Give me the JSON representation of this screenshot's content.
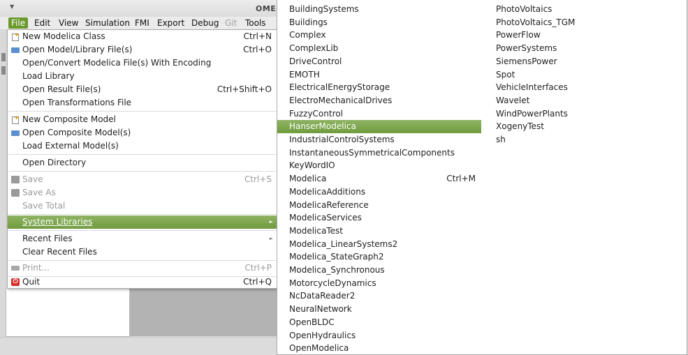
{
  "window": {
    "title_fragment": "OMEd"
  },
  "menubar": [
    {
      "label": "File",
      "state": "active"
    },
    {
      "label": "Edit",
      "state": "normal"
    },
    {
      "label": "View",
      "state": "normal"
    },
    {
      "label": "Simulation",
      "state": "normal"
    },
    {
      "label": "FMI",
      "state": "normal"
    },
    {
      "label": "Export",
      "state": "normal"
    },
    {
      "label": "Debug",
      "state": "normal"
    },
    {
      "label": "Git",
      "state": "disabled"
    },
    {
      "label": "Tools",
      "state": "normal"
    }
  ],
  "file_menu": {
    "items": [
      {
        "label": "New Modelica Class",
        "shortcut": "Ctrl+N",
        "icon": "new-icon"
      },
      {
        "label": "Open Model/Library File(s)",
        "shortcut": "Ctrl+O",
        "icon": "folder-icon"
      },
      {
        "label": "Open/Convert Modelica File(s) With Encoding",
        "shortcut": ""
      },
      {
        "label": "Load Library",
        "shortcut": ""
      },
      {
        "label": "Open Result File(s)",
        "shortcut": "Ctrl+Shift+O"
      },
      {
        "label": "Open Transformations File",
        "shortcut": ""
      },
      {
        "label": "New Composite Model",
        "shortcut": "",
        "icon": "new-icon"
      },
      {
        "label": "Open Composite Model(s)",
        "shortcut": "",
        "icon": "folder-icon"
      },
      {
        "label": "Load External Model(s)",
        "shortcut": ""
      },
      {
        "label": "Open Directory",
        "shortcut": ""
      },
      {
        "label": "Save",
        "shortcut": "Ctrl+S",
        "icon": "save-icon",
        "disabled": true
      },
      {
        "label": "Save As",
        "shortcut": "",
        "icon": "save-icon",
        "disabled": true
      },
      {
        "label": "Save Total",
        "shortcut": "",
        "disabled": true
      },
      {
        "label": "System Libraries",
        "shortcut": "",
        "highlighted": true,
        "submenu": true
      },
      {
        "label": "Recent Files",
        "shortcut": "",
        "submenu": true
      },
      {
        "label": "Clear Recent Files",
        "shortcut": ""
      },
      {
        "label": "Print...",
        "shortcut": "Ctrl+P",
        "icon": "printer-icon",
        "disabled": true
      },
      {
        "label": "Quit",
        "shortcut": "Ctrl+Q",
        "icon": "power-icon"
      }
    ]
  },
  "system_libraries": {
    "column1": [
      "BuildingSystems",
      "Buildings",
      "Complex",
      "ComplexLib",
      "DriveControl",
      "EMOTH",
      "ElectricalEnergyStorage",
      "ElectroMechanicalDrives",
      "FuzzyControl",
      "HanserModelica",
      "IndustrialControlSystems",
      "InstantaneousSymmetricalComponents",
      "KeyWordIO",
      "Modelica",
      "ModelicaAdditions",
      "ModelicaReference",
      "ModelicaServices",
      "ModelicaTest",
      "Modelica_LinearSystems2",
      "Modelica_StateGraph2",
      "Modelica_Synchronous",
      "MotorcycleDynamics",
      "NcDataReader2",
      "NeuralNetwork",
      "OpenBLDC",
      "OpenHydraulics",
      "OpenModelica"
    ],
    "column2": [
      "PhotoVoltaics",
      "PhotoVoltaics_TGM",
      "PowerFlow",
      "PowerSystems",
      "SiemensPower",
      "Spot",
      "VehicleInterfaces",
      "Wavelet",
      "WindPowerPlants",
      "XogenyTest",
      "sh"
    ],
    "highlighted": "HanserModelica",
    "modelica_shortcut": "Ctrl+M"
  },
  "colors": {
    "highlight": "#7aa547",
    "menu_bg": "#ffffff",
    "app_bg": "#d9d9d9"
  }
}
